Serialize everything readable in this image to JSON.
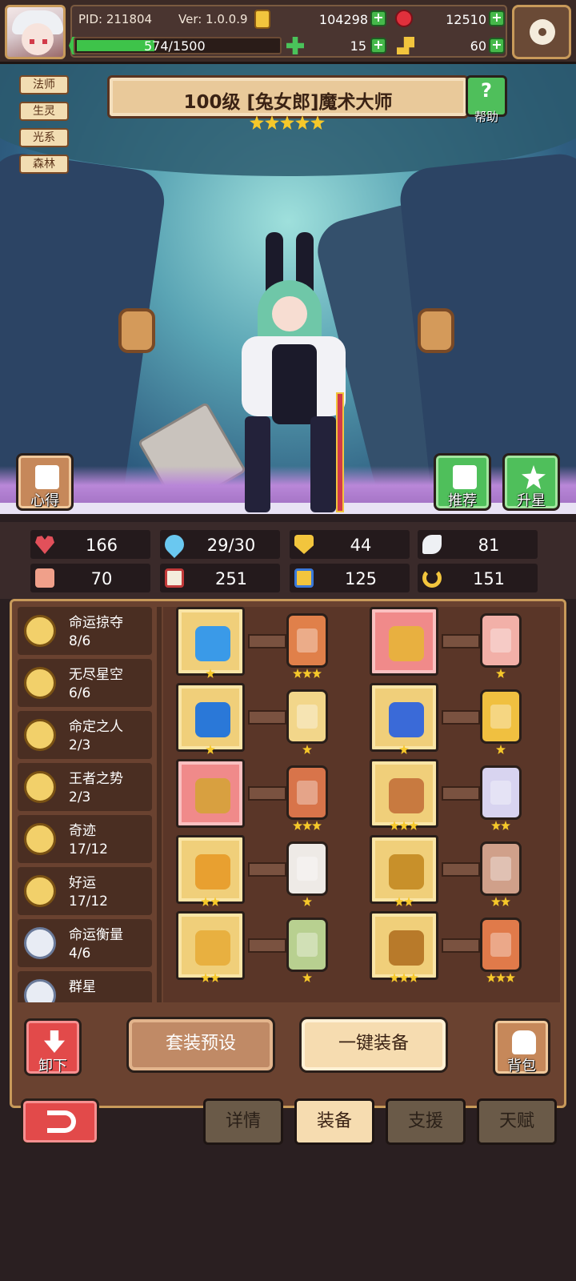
{
  "header": {
    "pid": "PID: 211804",
    "version": "Ver: 1.0.0.9",
    "gold": "104298",
    "gems": "12510",
    "xp": "574/1500",
    "xp_progress": 0.383,
    "clover": "15",
    "keys": "60"
  },
  "hero": {
    "title": "100级 [兔女郎]魔术大师",
    "stars": 5,
    "tags": [
      "法师",
      "生灵",
      "光系",
      "森林"
    ]
  },
  "buttons": {
    "help": "帮助",
    "notes": "心得",
    "recommend": "推荐",
    "star_up": "升星",
    "unequip": "卸下",
    "preset": "套装预设",
    "auto_equip": "一键装备",
    "bag": "背包"
  },
  "stats": {
    "hp": "166",
    "mana": "29/30",
    "defense": "44",
    "speed": "81",
    "attack": "70",
    "magic": "251",
    "crit": "125",
    "luck": "151"
  },
  "sets": [
    {
      "name": "命运掠夺",
      "count": "8/6"
    },
    {
      "name": "无尽星空",
      "count": "6/6"
    },
    {
      "name": "命定之人",
      "count": "2/3"
    },
    {
      "name": "王者之势",
      "count": "2/3"
    },
    {
      "name": "奇迹",
      "count": "17/12"
    },
    {
      "name": "好运",
      "count": "17/12"
    },
    {
      "name": "命运衡量",
      "count": "4/6"
    },
    {
      "name": "群星",
      "count": ""
    }
  ],
  "equipment": [
    {
      "slot": "staff-icon",
      "item_stars": 1,
      "card_stars": 3,
      "card_color": "#e0804a"
    },
    {
      "slot": "hat-icon",
      "item_stars": 0,
      "card_stars": 1,
      "card_color": "#f2b0a8"
    },
    {
      "slot": "orb-icon",
      "item_stars": 1,
      "card_stars": 1,
      "card_color": "#f2d68a"
    },
    {
      "slot": "heart-gem-icon",
      "item_stars": 1,
      "card_stars": 1,
      "card_color": "#f0c040"
    },
    {
      "slot": "necklace-icon",
      "item_stars": 0,
      "card_stars": 3,
      "card_color": "#d8744a"
    },
    {
      "slot": "scroll-icon",
      "item_stars": 3,
      "card_stars": 2,
      "card_color": "#d8d4f0"
    },
    {
      "slot": "jewel-frame-icon",
      "item_stars": 2,
      "card_stars": 1,
      "card_color": "#eeeae6"
    },
    {
      "slot": "ring-icon",
      "item_stars": 2,
      "card_stars": 2,
      "card_color": "#d0a08a"
    },
    {
      "slot": "amulet-icon",
      "item_stars": 2,
      "card_stars": 1,
      "card_color": "#b8d090"
    },
    {
      "slot": "boots-icon",
      "item_stars": 3,
      "card_stars": 3,
      "card_color": "#e07a4a"
    }
  ],
  "tabs": [
    "详情",
    "装备",
    "支援",
    "天赋"
  ],
  "active_tab": "装备"
}
